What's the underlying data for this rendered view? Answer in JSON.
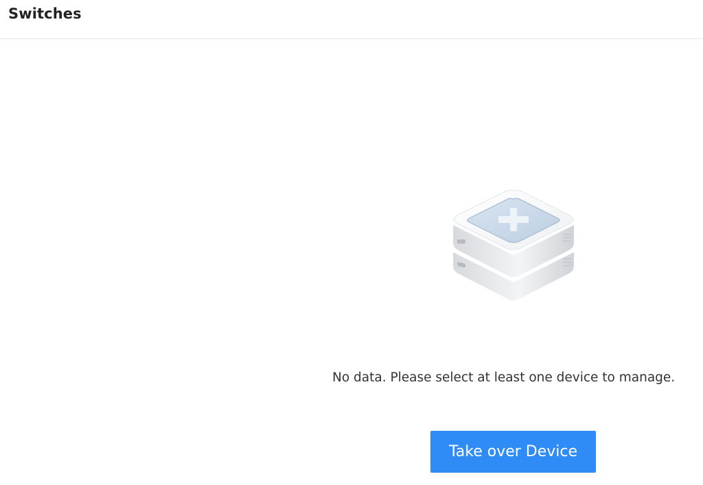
{
  "header": {
    "title": "Switches"
  },
  "empty_state": {
    "icon": "server-add-icon",
    "message": "No data. Please select at least one device to manage.",
    "action_label": "Take over Device"
  },
  "colors": {
    "accent": "#2f8cf7",
    "divider": "#e6e6e6",
    "text": "#333333"
  }
}
